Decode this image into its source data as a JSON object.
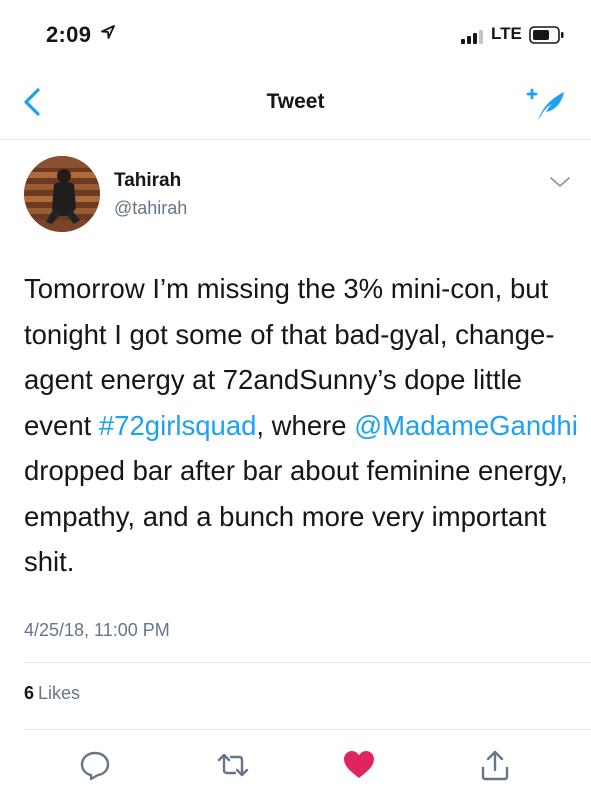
{
  "status_bar": {
    "time": "2:09",
    "network": "LTE"
  },
  "nav": {
    "title": "Tweet"
  },
  "author": {
    "name": "Tahirah",
    "handle": "@tahirah"
  },
  "tweet": {
    "text_parts": [
      {
        "text": "Tomorrow I’m missing the 3% mini-con, but tonight I got some of that bad-gyal, change-agent energy at 72andSunny’s dope little event ",
        "link": false
      },
      {
        "text": "#72girlsquad",
        "link": true
      },
      {
        "text": ", where ",
        "link": false
      },
      {
        "text": "@MadameGandhi",
        "link": true
      },
      {
        "text": " dropped bar after bar about feminine energy, empathy, and a bunch more very important shit.",
        "link": false
      }
    ],
    "timestamp": "4/25/18, 11:00 PM",
    "likes_count": "6",
    "likes_label": "Likes"
  },
  "icons": {
    "back": "chevron-left-icon",
    "compose": "compose-tweet-icon",
    "more": "chevron-down-icon",
    "reply": "reply-icon",
    "retweet": "retweet-icon",
    "like": "heart-icon",
    "share": "share-icon"
  },
  "colors": {
    "accent": "#1da1f2",
    "like": "#e0245e",
    "secondary_text": "#657786",
    "divider": "#e1e8ed"
  }
}
